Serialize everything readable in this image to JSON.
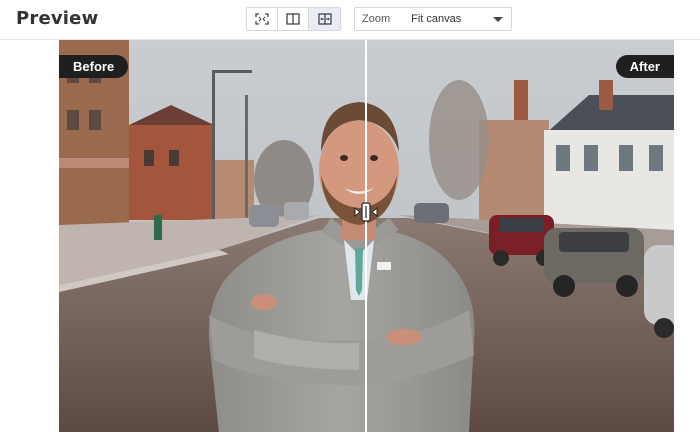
{
  "header": {
    "title": "Preview",
    "view_modes": [
      {
        "icon": "fit-screen-icon",
        "active": false
      },
      {
        "icon": "side-by-side-icon",
        "active": false
      },
      {
        "icon": "split-slider-icon",
        "active": true
      }
    ],
    "zoom": {
      "label": "Zoom",
      "value": "Fit canvas"
    }
  },
  "preview": {
    "before_label": "Before",
    "after_label": "After",
    "split_fraction": 0.5
  },
  "colors": {
    "tag_background": "#1f1f1f",
    "active_button": "#e8edf5",
    "divider": "#ffffff"
  }
}
